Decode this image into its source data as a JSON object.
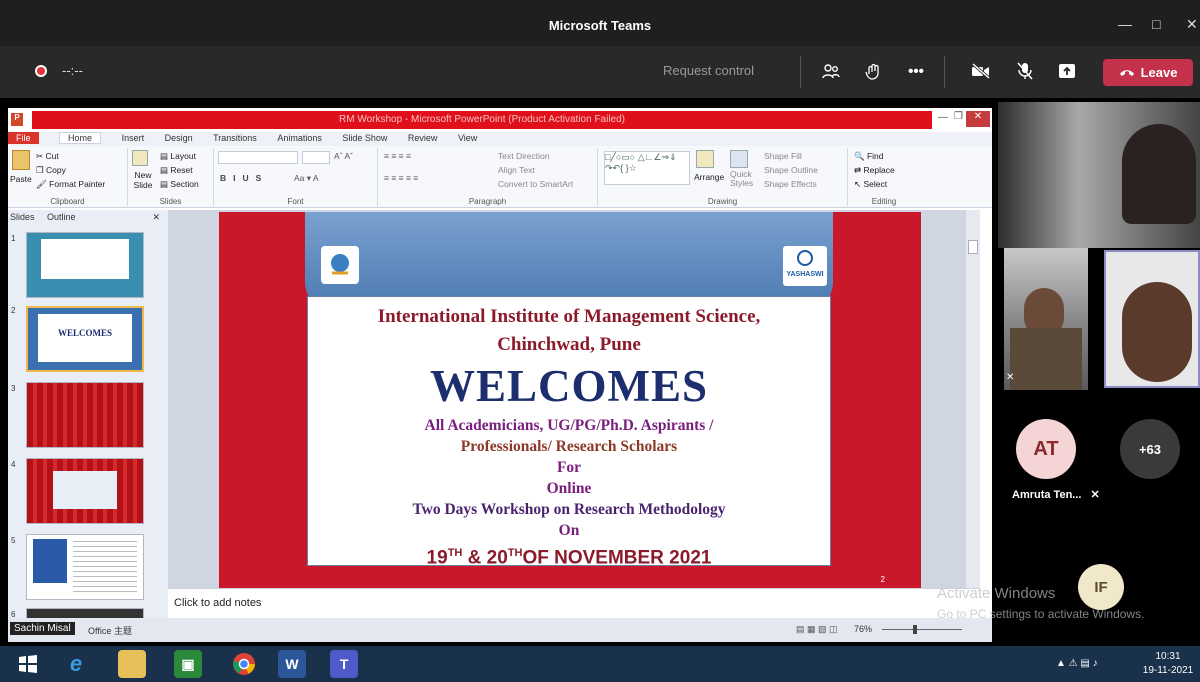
{
  "teams": {
    "title": "Microsoft Teams",
    "timer": "--:--",
    "request_control": "Request control",
    "leave_label": "Leave"
  },
  "ppt": {
    "title": "RM Workshop - Microsoft PowerPoint (Product Activation Failed)",
    "tabs": [
      "File",
      "Home",
      "Insert",
      "Design",
      "Transitions",
      "Animations",
      "Slide Show",
      "Review",
      "View"
    ],
    "clipboard": {
      "paste": "Paste",
      "cut": "Cut",
      "copy": "Copy",
      "format_painter": "Format Painter",
      "label": "Clipboard"
    },
    "slides": {
      "new_slide": "New Slide",
      "layout": "Layout",
      "reset": "Reset",
      "section": "Section",
      "label": "Slides"
    },
    "font": {
      "label": "Font"
    },
    "paragraph": {
      "text_direction": "Text Direction",
      "align_text": "Align Text",
      "smartart": "Convert to SmartArt",
      "label": "Paragraph"
    },
    "drawing": {
      "arrange": "Arrange",
      "quick_styles": "Quick Styles",
      "shape_fill": "Shape Fill",
      "shape_outline": "Shape Outline",
      "shape_effects": "Shape Effects",
      "label": "Drawing"
    },
    "editing": {
      "find": "Find",
      "replace": "Replace",
      "select": "Select",
      "label": "Editing"
    },
    "pane_tabs": {
      "slides": "Slides",
      "outline": "Outline"
    },
    "slide_numbers": [
      "1",
      "2",
      "3",
      "4",
      "5",
      "6"
    ],
    "thumb1_title": "WELCOMES",
    "notes_placeholder": "Click to add notes",
    "status": {
      "office_theme": "Office 主题",
      "zoom": "76%"
    },
    "presenter_tag": "Sachin Misal"
  },
  "slide": {
    "logo_text": "YASHASWI",
    "line1": "International Institute of Management Science,",
    "line2": "Chinchwad, Pune",
    "line3": "WELCOMES",
    "line4": "All  Academicians, UG/PG/Ph.D. Aspirants /",
    "line5": "Professionals/ Research Scholars",
    "line6": "For",
    "line7": "Online",
    "line8": "Two Days Workshop on Research Methodology",
    "line9": "On",
    "date_a": "19",
    "date_sup1": "TH",
    "date_b": " & 20",
    "date_sup2": "TH",
    "date_c": "OF NOVEMBER 2021",
    "page_num": "2"
  },
  "participants": {
    "avatar_at": "AT",
    "more": "+63",
    "name_at": "Amruta Ten...",
    "avatar_if": "IF",
    "activate_title": "Activate Windows",
    "activate_sub": "Go to PC settings to activate Windows."
  },
  "taskbar": {
    "time": "10:31",
    "date": "19-11-2021"
  }
}
